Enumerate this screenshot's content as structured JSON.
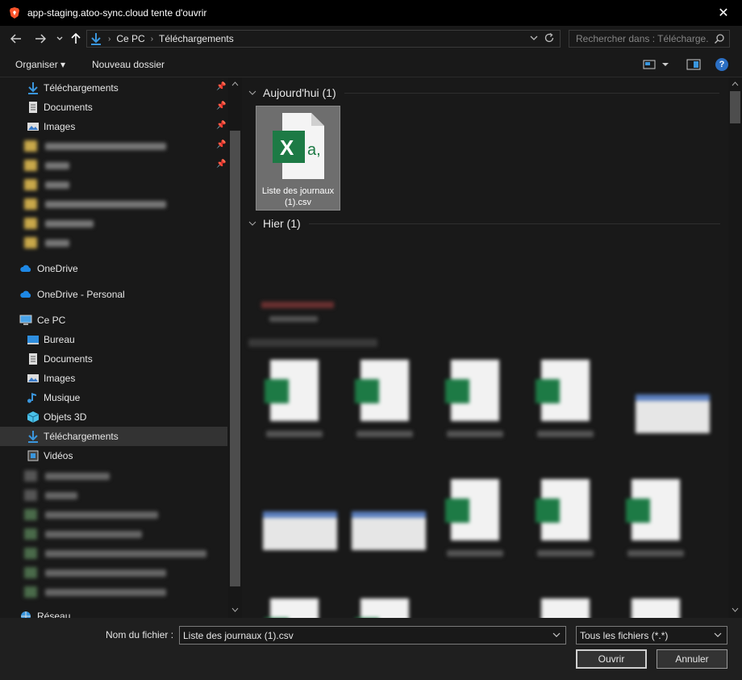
{
  "window": {
    "title": "app-staging.atoo-sync.cloud tente d'ouvrir",
    "close_glyph": "✕"
  },
  "nav": {
    "breadcrumbs": [
      "Ce PC",
      "Téléchargements"
    ],
    "search_placeholder": "Rechercher dans : Télécharge..."
  },
  "toolbar": {
    "organize_label": "Organiser ▾",
    "new_folder_label": "Nouveau dossier",
    "help_glyph": "?"
  },
  "sidebar": {
    "quick_access": [
      {
        "label": "Téléchargements",
        "icon": "download-icon"
      },
      {
        "label": "Documents",
        "icon": "documents-icon"
      },
      {
        "label": "Images",
        "icon": "images-icon"
      }
    ],
    "onedrive_label": "OneDrive",
    "onedrive_personal_label": "OneDrive - Personal",
    "this_pc_label": "Ce PC",
    "this_pc_items": [
      {
        "label": "Bureau",
        "icon": "desktop-icon"
      },
      {
        "label": "Documents",
        "icon": "documents-icon"
      },
      {
        "label": "Images",
        "icon": "images-icon"
      },
      {
        "label": "Musique",
        "icon": "music-icon"
      },
      {
        "label": "Objets 3D",
        "icon": "3d-objects-icon"
      },
      {
        "label": "Téléchargements",
        "icon": "download-icon"
      },
      {
        "label": "Vidéos",
        "icon": "videos-icon"
      }
    ],
    "network_label": "Réseau",
    "pin_glyph": "📌"
  },
  "content": {
    "groups": [
      {
        "label": "Aujourd'hui (1)"
      },
      {
        "label": "Hier (1)"
      }
    ],
    "selected_file": {
      "name": "Liste des journaux (1).csv",
      "icon": "excel-csv-icon",
      "x_letter": "X",
      "a_letter": "a,"
    }
  },
  "bottom": {
    "filename_label": "Nom du fichier :",
    "filename_value": "Liste des journaux (1).csv",
    "filetype_value": "Tous les fichiers (*.*)",
    "open_label": "Ouvrir",
    "cancel_label": "Annuler"
  },
  "colors": {
    "background": "#191919",
    "titlebar": "#000000",
    "selected_row": "#333333",
    "excel_green": "#1d7a45",
    "accent_blue": "#3a96dd"
  }
}
